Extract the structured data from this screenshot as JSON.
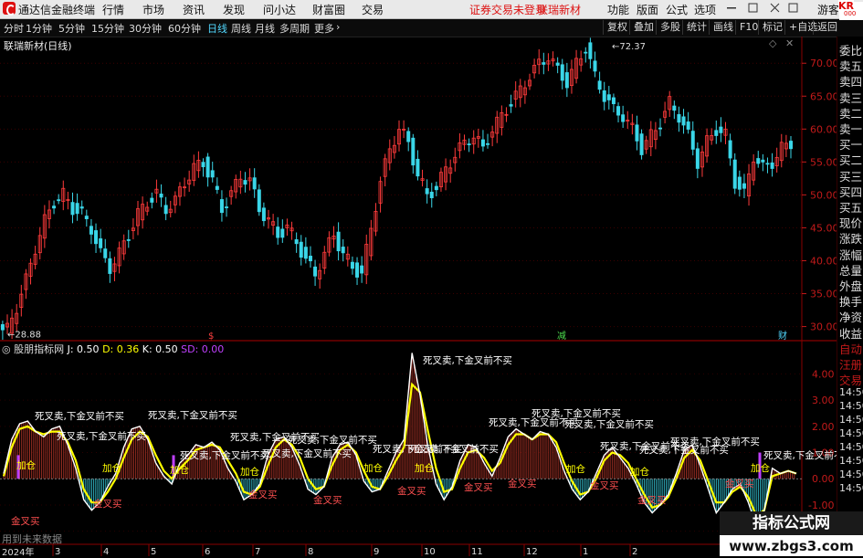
{
  "menubar": {
    "app_name": "通达信金融终端",
    "menus": [
      "行情",
      "市场",
      "资讯",
      "发现",
      "问小达",
      "财富圈",
      "交易"
    ],
    "status": "证券交易未登录",
    "stock_name": "联瑞新材",
    "right_items": [
      "功能",
      "版面",
      "公式",
      "选项"
    ],
    "guest": "游客"
  },
  "toolbar": {
    "periods": [
      "分时",
      "1分钟",
      "5分钟",
      "15分钟",
      "30分钟",
      "60分钟",
      "日线",
      "周线",
      "月线",
      "多周期",
      "更多"
    ],
    "active_period": "日线",
    "more_icon": "chevron-right-icon",
    "right_buttons": [
      "复权",
      "叠加",
      "多股",
      "统计",
      "画线",
      "F10",
      "标记",
      "+自选",
      "返回"
    ]
  },
  "main_chart": {
    "title": "联瑞新材(日线)",
    "high_label": "72.37",
    "low_label": "28.88",
    "markers": [
      "$",
      "减",
      "财"
    ]
  },
  "indicator": {
    "name": "股朋指标网",
    "j_label": "J: 0.50",
    "d_label": "D: 0.36",
    "k_label": "K: 0.50",
    "sd_label": "SD: 0.00",
    "sell_signal": "死叉卖,下金叉前不买",
    "buy_signal": "金叉买",
    "add_signal": "加仓",
    "footer_note": "用到未来数据"
  },
  "x_axis": {
    "year_label": "2024年",
    "months": [
      "3",
      "4",
      "5",
      "6",
      "7",
      "8",
      "9",
      "10",
      "11",
      "12",
      "1",
      "2"
    ]
  },
  "right_panel": {
    "code_label": "KR",
    "code_sub": "000",
    "items": [
      "委比",
      "卖五",
      "卖四",
      "卖三",
      "卖二",
      "卖一",
      "买一",
      "买二",
      "买三",
      "买四",
      "买五",
      "现价",
      "涨跌",
      "涨幅",
      "总量",
      "外盘",
      "换手",
      "净资",
      "收益",
      "自动",
      "汪册",
      "交易"
    ],
    "times": [
      "14:50",
      "14:50",
      "14:50",
      "14:50",
      "14:50",
      "14:50",
      "14:50",
      "14:50"
    ]
  },
  "watermark": {
    "line1": "指标公式网",
    "line2": "www.zbgs3.com"
  },
  "colors": {
    "up": "#ff3b3b",
    "down": "#3ad6e8",
    "axis_red": "#c21a1a",
    "k_line": "#ffffff",
    "d_line": "#ffff00",
    "active": "#52d8ff",
    "purple": "#c040ff"
  },
  "chart_data": [
    {
      "type": "candlestick",
      "title": "联瑞新材(日线)",
      "y_ticks": [
        30,
        35,
        40,
        45,
        50,
        55,
        60,
        65,
        70
      ],
      "ylim": [
        28,
        73.5
      ],
      "x_ticks": [
        "2024年",
        "3",
        "4",
        "5",
        "6",
        "7",
        "8",
        "9",
        "10",
        "11",
        "12",
        "1",
        "2"
      ],
      "high": 72.37,
      "low": 28.88,
      "close_path": [
        29.5,
        33,
        37,
        42,
        46,
        49,
        50,
        48,
        47,
        45,
        41,
        39,
        41,
        44,
        47,
        49,
        50,
        48,
        49,
        52,
        54,
        55,
        52,
        48,
        50,
        53,
        52,
        48,
        46,
        44,
        45,
        43,
        40,
        38,
        41,
        44,
        41,
        39,
        38,
        45,
        52,
        57,
        60,
        58,
        53,
        50,
        51,
        54,
        56,
        58,
        59,
        57,
        60,
        62,
        64,
        66,
        68,
        70,
        71,
        69,
        67,
        70,
        72.37,
        68,
        65,
        63,
        62,
        60,
        57,
        59,
        61,
        64,
        62,
        59,
        55,
        58,
        60,
        59,
        52,
        50,
        56,
        54,
        55,
        57,
        58
      ]
    },
    {
      "type": "line",
      "title": "股朋指标网",
      "y_ticks": [
        -2.0,
        -1.0,
        0.0,
        1.0,
        2.0,
        3.0,
        4.0
      ],
      "ylim": [
        -2.5,
        5.2
      ],
      "series": [
        {
          "name": "K",
          "values": [
            0.2,
            1.5,
            2.1,
            2.2,
            1.8,
            1.6,
            1.9,
            2.0,
            1.3,
            0.4,
            -0.8,
            -1.2,
            -0.9,
            -0.3,
            0.2,
            1.2,
            1.9,
            2.0,
            1.5,
            0.6,
            0.1,
            -0.2,
            0.6,
            0.9,
            1.3,
            1.2,
            1.4,
            1.1,
            0.4,
            -0.1,
            -0.8,
            -0.6,
            -0.2,
            0.9,
            1.5,
            1.6,
            1.2,
            0.5,
            -0.4,
            -0.6,
            -0.3,
            0.8,
            1.3,
            1.4,
            0.9,
            -0.1,
            -0.5,
            -0.4,
            0.3,
            1.0,
            1.5,
            4.8,
            3.2,
            1.2,
            -0.2,
            -0.8,
            -0.3,
            0.7,
            1.3,
            1.2,
            0.6,
            0.1,
            0.8,
            1.6,
            1.9,
            1.7,
            1.5,
            1.8,
            1.7,
            1.2,
            0.3,
            -0.4,
            -0.8,
            -0.5,
            0.2,
            0.9,
            1.2,
            0.8,
            0.4,
            -0.2,
            -0.9,
            -1.3,
            -1.0,
            -0.6,
            0.2,
            1.1,
            1.3,
            0.5,
            -0.4,
            -1.3,
            -0.9,
            -0.4,
            -0.2,
            -0.9,
            -1.8,
            -1.2,
            0.4,
            0.2,
            0.3,
            0.2
          ]
        },
        {
          "name": "D",
          "values": [
            0.1,
            1.2,
            1.9,
            2.0,
            1.8,
            1.7,
            1.8,
            1.8,
            1.4,
            0.7,
            -0.4,
            -0.9,
            -0.9,
            -0.5,
            0.0,
            0.8,
            1.5,
            1.8,
            1.6,
            0.9,
            0.3,
            0.0,
            0.4,
            0.7,
            1.1,
            1.2,
            1.3,
            1.2,
            0.7,
            0.2,
            -0.5,
            -0.6,
            -0.3,
            0.5,
            1.2,
            1.5,
            1.3,
            0.8,
            0.0,
            -0.4,
            -0.3,
            0.5,
            1.1,
            1.3,
            1.0,
            0.3,
            -0.3,
            -0.4,
            0.1,
            0.7,
            1.2,
            3.6,
            3.3,
            1.8,
            0.4,
            -0.5,
            -0.4,
            0.4,
            1.0,
            1.1,
            0.8,
            0.3,
            0.6,
            1.3,
            1.7,
            1.7,
            1.5,
            1.7,
            1.7,
            1.4,
            0.6,
            -0.1,
            -0.6,
            -0.5,
            0.0,
            0.7,
            1.0,
            0.9,
            0.6,
            0.0,
            -0.6,
            -1.1,
            -1.0,
            -0.7,
            0.0,
            0.8,
            1.1,
            0.7,
            -0.1,
            -0.9,
            -0.9,
            -0.5,
            -0.3,
            -0.7,
            -1.4,
            -1.2,
            0.1,
            0.2,
            0.3,
            0.2
          ]
        }
      ]
    }
  ]
}
